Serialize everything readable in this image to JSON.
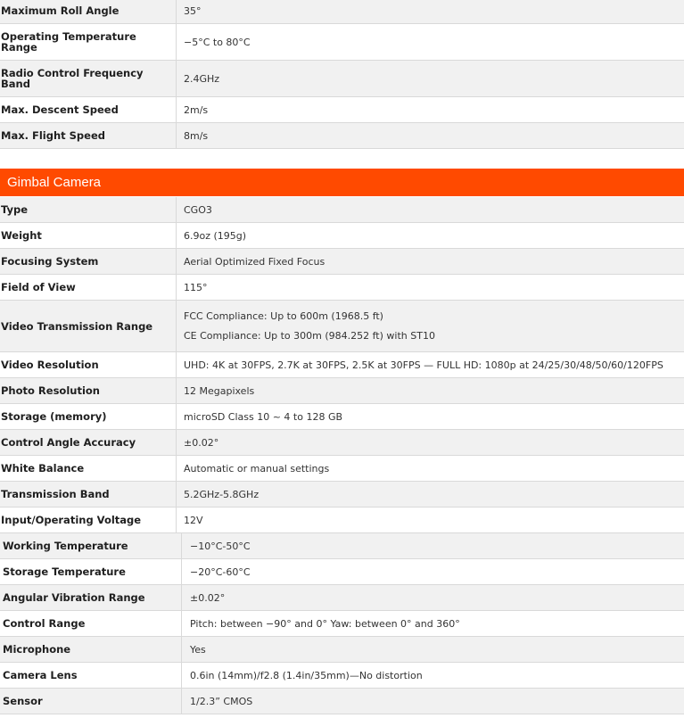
{
  "top_specs": [
    {
      "label": "Maximum Roll Angle",
      "value": "35°"
    },
    {
      "label": "Operating Temperature Range",
      "value": "−5°C to 80°C"
    },
    {
      "label": "Radio Control Frequency Band",
      "value": "2.4GHz"
    },
    {
      "label": "Max. Descent Speed",
      "value": "2m/s"
    },
    {
      "label": "Max. Flight Speed",
      "value": "8m/s"
    }
  ],
  "section": {
    "title": "Gimbal Camera",
    "accent_color": "#ff4a00"
  },
  "camera_specs": [
    {
      "label": "Type",
      "value": "CGO3"
    },
    {
      "label": "Weight",
      "value": "6.9oz (195g)"
    },
    {
      "label": "Focusing System",
      "value": "Aerial Optimized Fixed Focus"
    },
    {
      "label": "Field of View",
      "value": "115°"
    },
    {
      "label": "Video Transmission Range",
      "value_lines": [
        "FCC Compliance: Up to 600m (1968.5 ft)",
        "CE Compliance: Up to 300m (984.252 ft) with ST10"
      ]
    },
    {
      "label": "Video Resolution",
      "value": "UHD: 4K at 30FPS, 2.7K at 30FPS, 2.5K at 30FPS — FULL HD: 1080p at 24/25/30/48/50/60/120FPS"
    },
    {
      "label": "Photo Resolution",
      "value": "12 Megapixels"
    },
    {
      "label": "Storage (memory)",
      "value": "microSD Class 10 ~ 4 to 128 GB"
    },
    {
      "label": "Control Angle Accuracy",
      "value": "±0.02°"
    },
    {
      "label": "White Balance",
      "value": "Automatic or manual settings"
    },
    {
      "label": "Transmission Band",
      "value": "5.2GHz-5.8GHz"
    },
    {
      "label": "Input/Operating Voltage",
      "value": "12V"
    }
  ],
  "extra_specs": [
    {
      "label": "Working Temperature",
      "value": "−10°C-50°C"
    },
    {
      "label": "Storage Temperature",
      "value": "−20°C-60°C"
    },
    {
      "label": "Angular Vibration Range",
      "value": "±0.02°"
    },
    {
      "label": "Control Range",
      "value": "Pitch: between −90° and 0° Yaw: between 0° and 360°"
    },
    {
      "label": "Microphone",
      "value": "Yes"
    },
    {
      "label": "Camera Lens",
      "value": "0.6in (14mm)/f2.8 (1.4in/35mm)—No distortion"
    },
    {
      "label": "Sensor",
      "value": "1/2.3” CMOS"
    }
  ]
}
